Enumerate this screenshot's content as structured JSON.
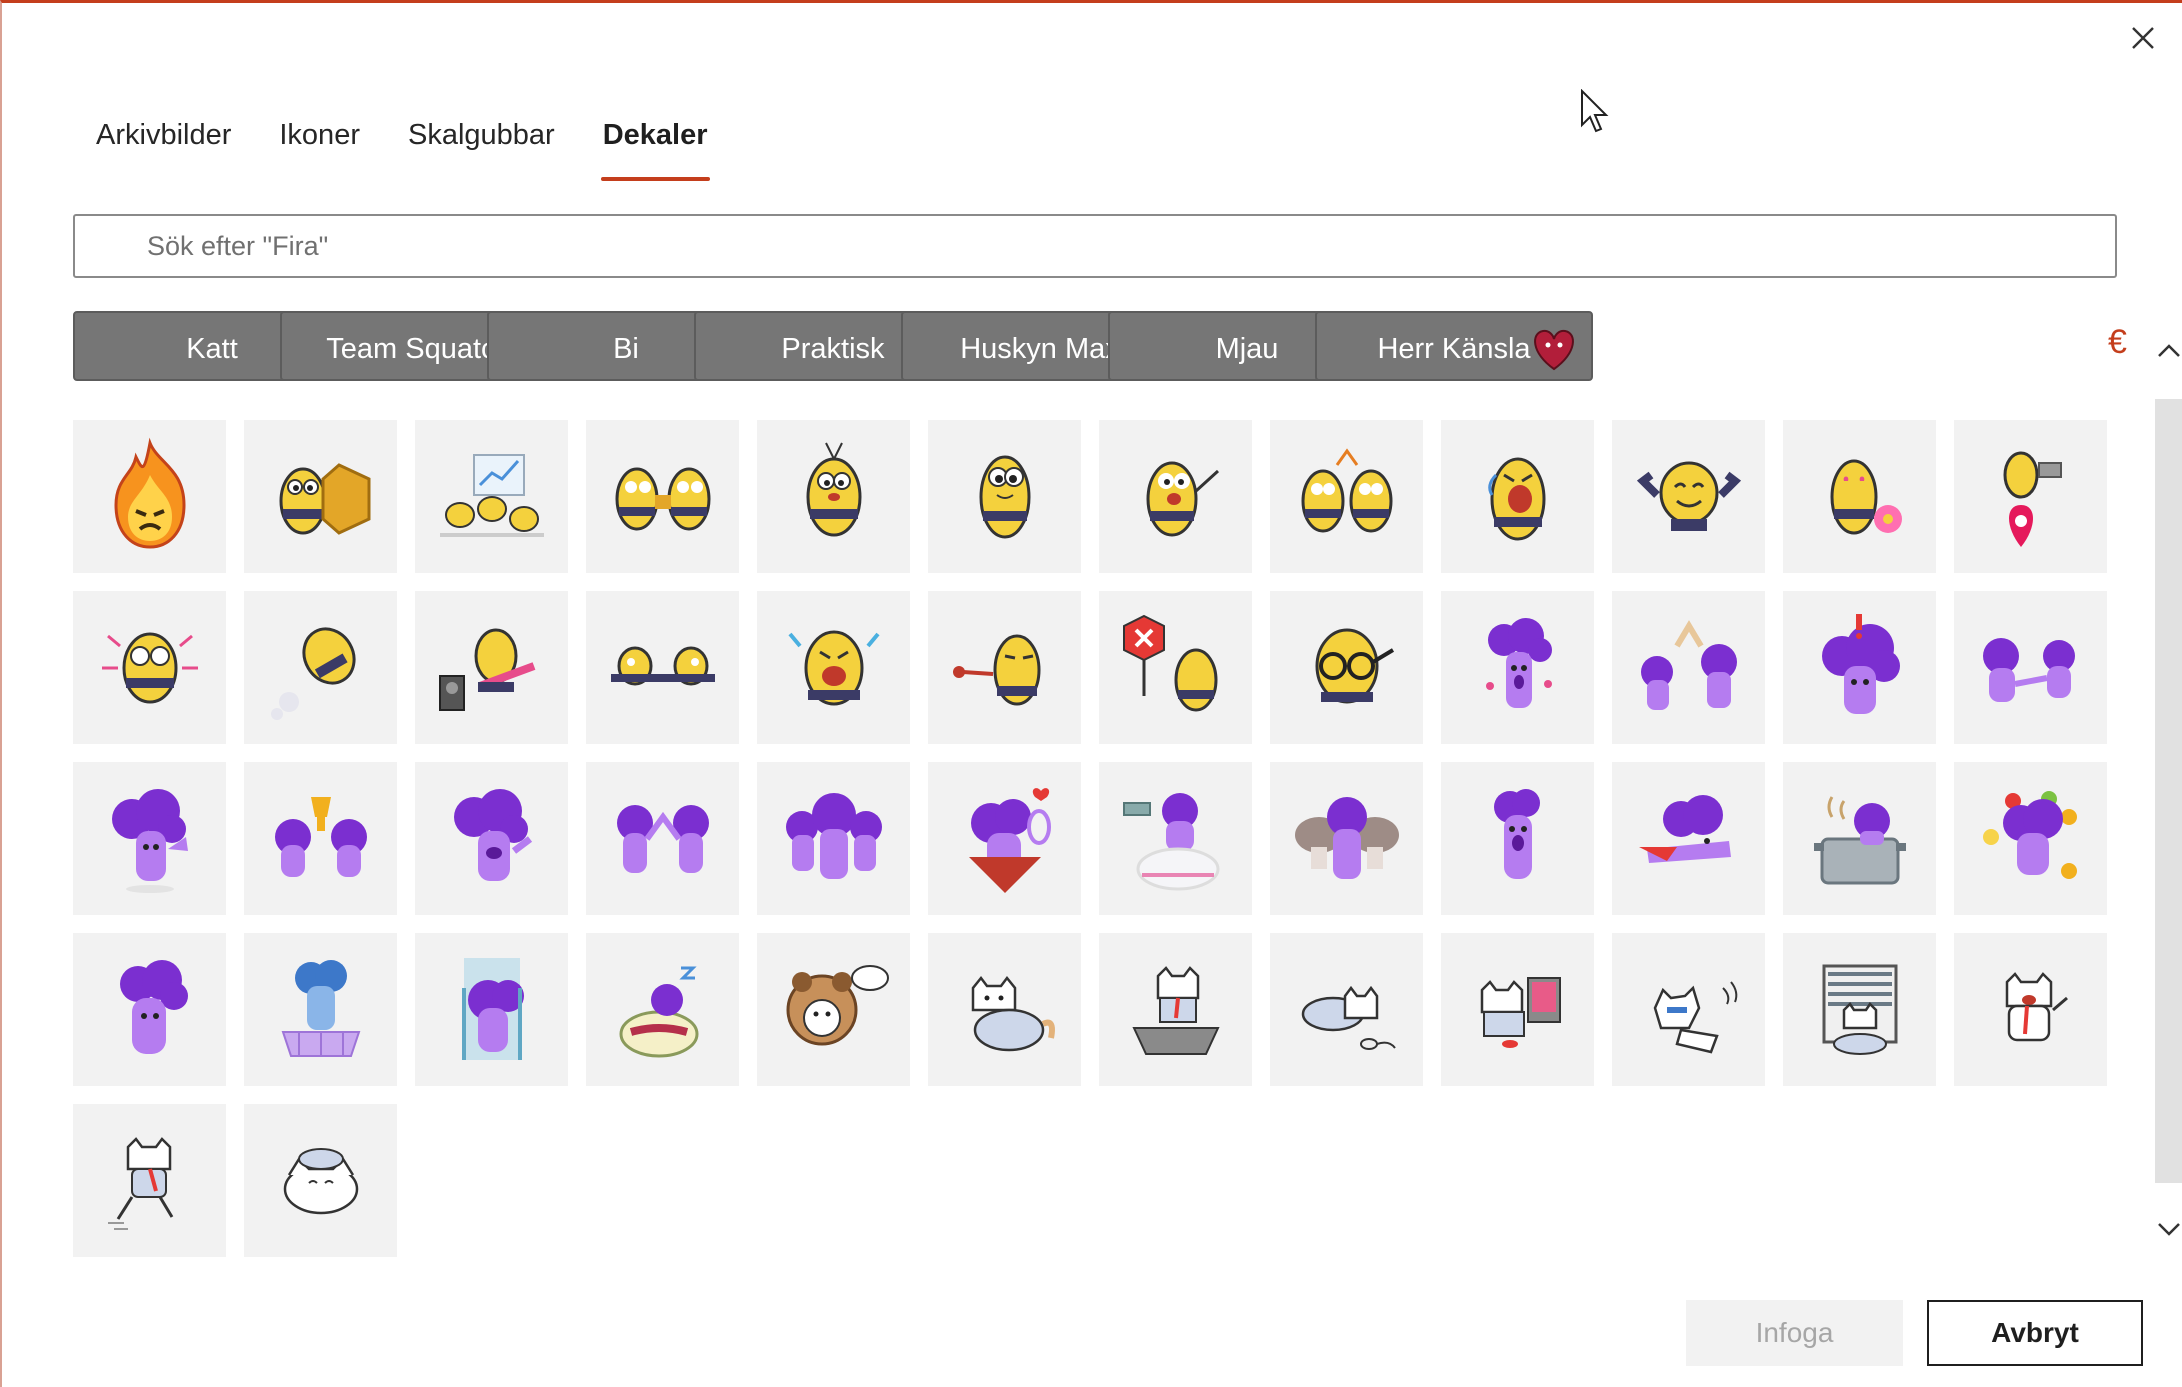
{
  "close_label": "×",
  "tabs": [
    {
      "label": "Arkivbilder",
      "active": false
    },
    {
      "label": "Ikoner",
      "active": false
    },
    {
      "label": "Skalgubbar",
      "active": false
    },
    {
      "label": "Dekaler",
      "active": true
    }
  ],
  "search": {
    "placeholder": "Sök efter \"Fira\"",
    "value": ""
  },
  "categories": [
    {
      "label": "Katt",
      "icon": "cat-thumb-icon"
    },
    {
      "label": "Team Squatch",
      "icon": "squatch-thumb-icon"
    },
    {
      "label": "Bi",
      "icon": "bee-thumb-icon"
    },
    {
      "label": "Praktisk",
      "icon": "glove-thumb-icon"
    },
    {
      "label": "Huskyn Max",
      "icon": "husky-thumb-icon"
    },
    {
      "label": "Mjau",
      "icon": "mjau-thumb-icon"
    },
    {
      "label": "Herr Känsla",
      "icon": "heart-thumb-icon"
    }
  ],
  "categories_more_glyph": "€",
  "stickers": [
    "fire",
    "bee",
    "bee",
    "bee",
    "bee",
    "bee",
    "bee",
    "bee",
    "bee",
    "bee",
    "bee",
    "bee",
    "bee",
    "bee",
    "bee",
    "bee",
    "bee",
    "bee",
    "bee",
    "bee",
    "purple",
    "purple",
    "purple",
    "purple",
    "purple",
    "purple",
    "purple",
    "purple",
    "purple",
    "purple",
    "purple",
    "purple",
    "purple",
    "purple",
    "purple",
    "purple",
    "purple",
    "purple",
    "purple",
    "purple",
    "dog",
    "cat",
    "cat",
    "cat",
    "cat",
    "cat",
    "cat",
    "cat",
    "cat",
    "cat"
  ],
  "buttons": {
    "insert": "Infoga",
    "cancel": "Avbryt"
  },
  "colors": {
    "accent": "#c43e1c",
    "category_bg": "#767676",
    "tile_bg": "#f2f2f2"
  }
}
